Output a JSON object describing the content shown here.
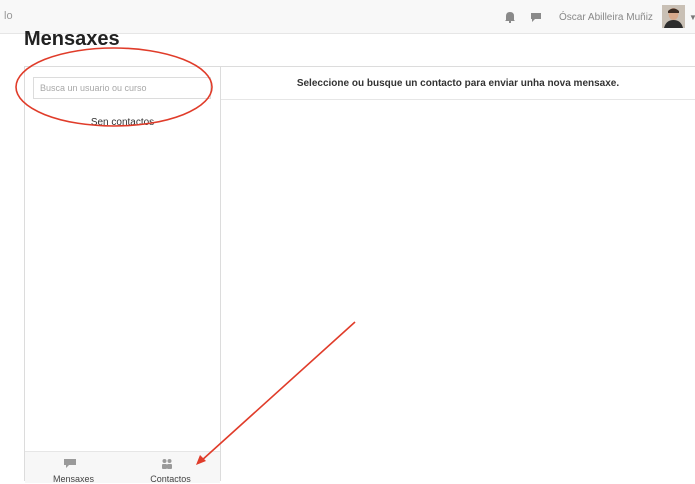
{
  "topbar": {
    "brand_fragment": "lo",
    "user_name": "Óscar Abilleira Muñiz",
    "icons": [
      "bell-icon",
      "message-icon",
      "avatar",
      "chevron-down-icon"
    ]
  },
  "page": {
    "title": "Mensaxes"
  },
  "left_panel": {
    "search_placeholder": "Busca un usuario ou curso",
    "empty_text": "Sen contactos",
    "tabs": [
      {
        "label": "Mensaxes",
        "icon": "message-icon"
      },
      {
        "label": "Contactos",
        "icon": "contacts-icon"
      }
    ]
  },
  "right_panel": {
    "header": "Seleccione ou busque un contacto para enviar unha nova mensaxe."
  },
  "annotations": {
    "color": "#e03c2a"
  }
}
